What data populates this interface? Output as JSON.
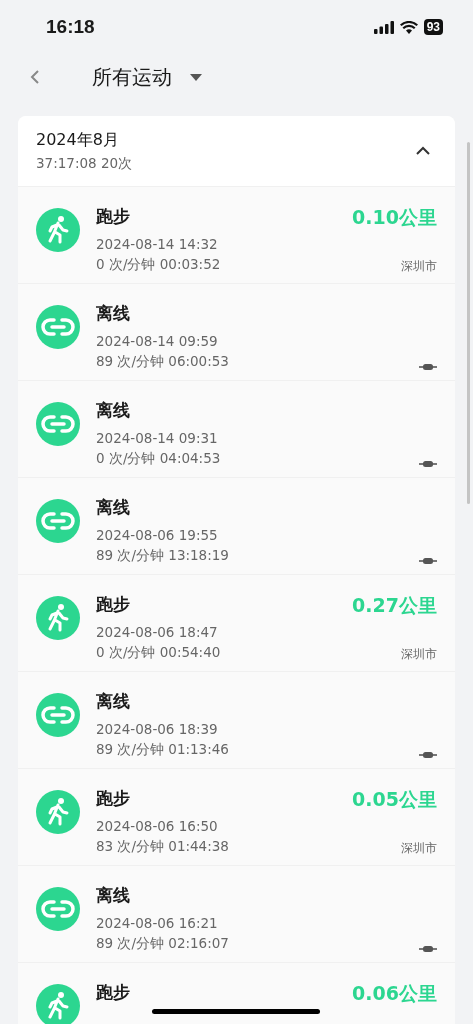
{
  "status_bar": {
    "time": "16:18",
    "battery": "93"
  },
  "nav": {
    "title": "所有运动"
  },
  "month": {
    "title": "2024年8月",
    "summary": "37:17:08 20次",
    "expanded": true
  },
  "activities": [
    {
      "kind": "run",
      "title": "跑步",
      "date": "2024-08-14 14:32",
      "stats": "0 次/分钟 00:03:52",
      "distance": "0.10公里",
      "place": "深圳市"
    },
    {
      "kind": "offline",
      "title": "离线",
      "date": "2024-08-14 09:59",
      "stats": "89 次/分钟 06:00:53"
    },
    {
      "kind": "offline",
      "title": "离线",
      "date": "2024-08-14 09:31",
      "stats": "0 次/分钟 04:04:53"
    },
    {
      "kind": "offline",
      "title": "离线",
      "date": "2024-08-06 19:55",
      "stats": "89 次/分钟 13:18:19"
    },
    {
      "kind": "run",
      "title": "跑步",
      "date": "2024-08-06 18:47",
      "stats": "0 次/分钟 00:54:40",
      "distance": "0.27公里",
      "place": "深圳市"
    },
    {
      "kind": "offline",
      "title": "离线",
      "date": "2024-08-06 18:39",
      "stats": "89 次/分钟 01:13:46"
    },
    {
      "kind": "run",
      "title": "跑步",
      "date": "2024-08-06 16:50",
      "stats": "83 次/分钟 01:44:38",
      "distance": "0.05公里",
      "place": "深圳市"
    },
    {
      "kind": "offline",
      "title": "离线",
      "date": "2024-08-06 16:21",
      "stats": "89 次/分钟 02:16:07"
    },
    {
      "kind": "run",
      "title": "跑步",
      "distance": "0.06公里"
    }
  ]
}
